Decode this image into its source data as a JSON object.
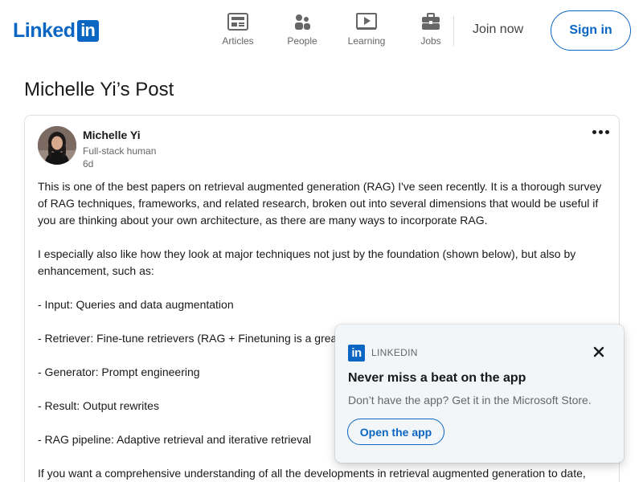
{
  "header": {
    "logo": {
      "text": "Linked",
      "box": "in"
    },
    "nav": [
      {
        "label": "Articles",
        "icon": "articles-icon"
      },
      {
        "label": "People",
        "icon": "people-icon"
      },
      {
        "label": "Learning",
        "icon": "learning-icon"
      },
      {
        "label": "Jobs",
        "icon": "jobs-icon"
      }
    ],
    "join_label": "Join now",
    "signin_label": "Sign in"
  },
  "page": {
    "title": "Michelle Yi’s Post"
  },
  "post": {
    "author": "Michelle Yi",
    "headline": "Full-stack human",
    "time": "6d",
    "paragraphs": [
      "This is one of the best papers on retrieval augmented generation (RAG) I've seen recently. It is a thorough survey of RAG techniques, frameworks, and related research, broken out into several dimensions that would be useful if you are thinking about your own architecture, as there are many ways to incorporate RAG.",
      "I especially also like how they look at major techniques not just by the foundation (shown below), but also by enhancement, such as:",
      "- Input: Queries and data augmentation",
      "- Retriever: Fine-tune retrievers (RAG + Finetuning is a great",
      "- Generator: Prompt engineering",
      "- Result: Output rewrites",
      "- RAG pipeline: Adaptive retrieval and iterative retrieval",
      "If you want a comprehensive understanding of all the developments in retrieval augmented generation to date,"
    ]
  },
  "toast": {
    "logo": "in",
    "brand": "LINKEDIN",
    "title": "Never miss a beat on the app",
    "text": "Don’t have the app? Get it in the Microsoft Store.",
    "button": "Open the app"
  },
  "colors": {
    "brand": "#0a66c2",
    "muted_text": "#666666",
    "toast_bg": "#f3f6f8"
  }
}
